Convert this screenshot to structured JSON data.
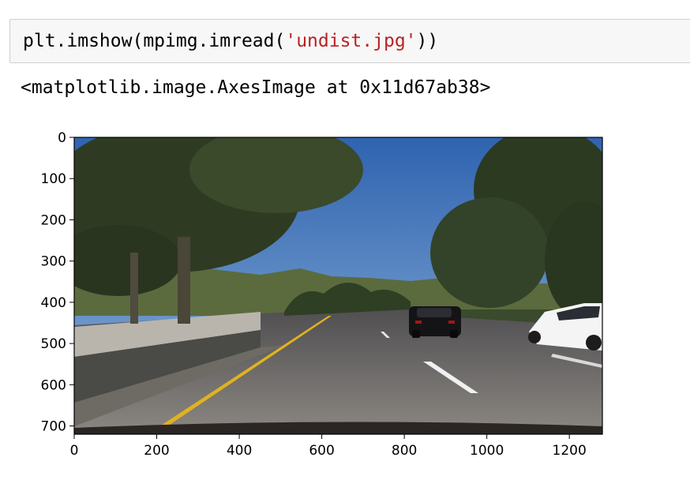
{
  "code_cell": {
    "prefix": "plt.imshow(mpimg.imread(",
    "string_literal": "'undist.jpg'",
    "suffix": "))"
  },
  "output_text": "<matplotlib.image.AxesImage at 0x11d67ab38>",
  "chart_data": {
    "type": "image",
    "xlim": [
      0,
      1280
    ],
    "ylim": [
      720,
      0
    ],
    "x_ticks": [
      0,
      200,
      400,
      600,
      800,
      1000,
      1200
    ],
    "y_ticks": [
      0,
      100,
      200,
      300,
      400,
      500,
      600,
      700
    ],
    "x_tick_labels": [
      "0",
      "200",
      "400",
      "600",
      "800",
      "1000",
      "1200"
    ],
    "y_tick_labels": [
      "0",
      "100",
      "200",
      "300",
      "400",
      "500",
      "600",
      "700"
    ],
    "grid": false
  },
  "colors": {
    "sky": "#3a6fb8",
    "road": "#6f6c69",
    "lane_yellow": "#e0b21f",
    "lane_white": "#f0f0f0"
  }
}
